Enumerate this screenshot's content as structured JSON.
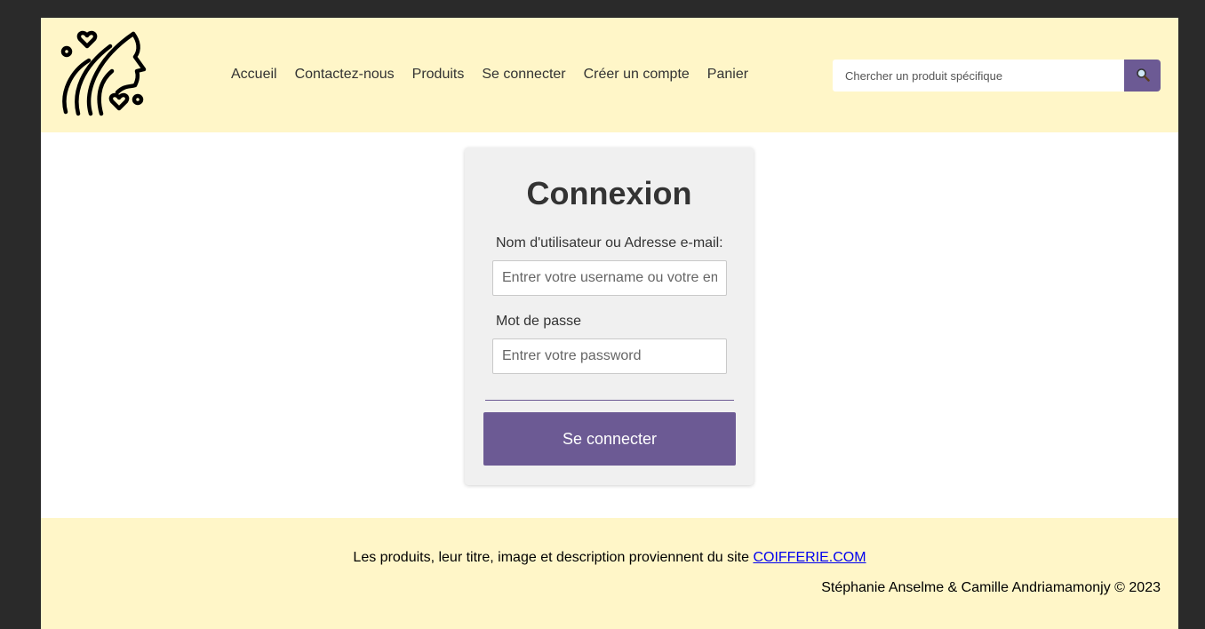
{
  "header": {
    "logo_icon": "woman-profile-hearts-logo",
    "nav": [
      {
        "label": "Accueil"
      },
      {
        "label": "Contactez-nous"
      },
      {
        "label": "Produits"
      },
      {
        "label": "Se connecter"
      },
      {
        "label": "Créer un compte"
      },
      {
        "label": "Panier"
      }
    ],
    "search": {
      "placeholder": "Chercher un produit spécifique",
      "value": "",
      "button_icon": "search-icon"
    }
  },
  "login": {
    "title": "Connexion",
    "username_label": "Nom d'utilisateur ou Adresse e-mail:",
    "username_placeholder": "Entrer votre username ou votre email",
    "password_label": "Mot de passe",
    "password_placeholder": "Entrer votre password",
    "submit_label": "Se connecter"
  },
  "footer": {
    "credit_text": "Les produits, leur titre, image et description proviennent du site ",
    "credit_link": "COIFFERIE.COM",
    "copyright": "Stéphanie Anselme & Camille Andriamamonjy © 2023"
  },
  "colors": {
    "window_background": "#2a2a2a",
    "header_footer": "#fff6c8",
    "accent": "#6c5a94",
    "card": "#f0f0f0",
    "text": "#333333",
    "link": "#0000ee"
  }
}
